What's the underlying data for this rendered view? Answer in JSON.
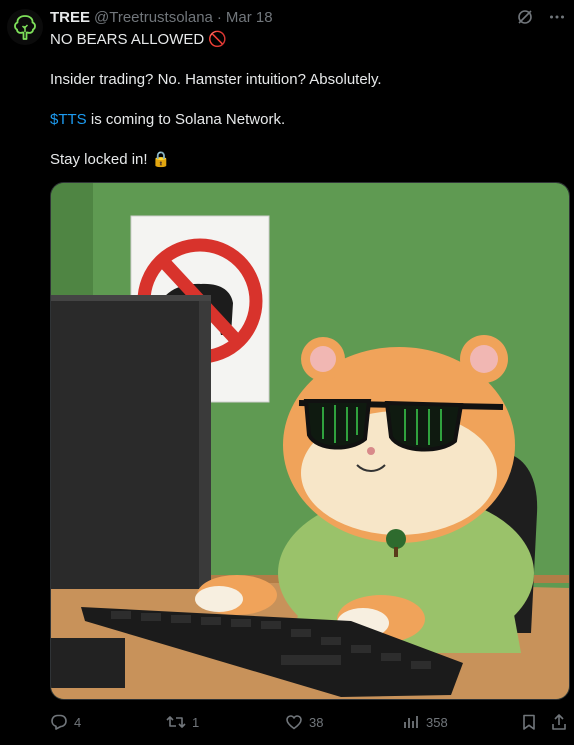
{
  "post": {
    "author_name": "TREE",
    "handle": "@Treetrustsolana",
    "separator": "·",
    "date": "Mar 18",
    "line1_text": "NO BEARS ALLOWED",
    "line1_emoji": "🚫",
    "line2": "Insider trading? No. Hamster intuition? Absolutely.",
    "line3_cashtag": "$TTS",
    "line3_rest": " is coming to Solana Network.",
    "line4_text": "Stay locked in!",
    "line4_emoji": "🔒"
  },
  "actions": {
    "replies": "4",
    "reposts": "1",
    "likes": "38",
    "views": "358"
  },
  "colors": {
    "background": "#000000",
    "text": "#e7e9ea",
    "muted": "#71767b",
    "link": "#1d9bf0",
    "avatar_tree": "#7ee05a"
  },
  "icons": [
    "tree-avatar-icon",
    "grok-icon",
    "more-icon",
    "reply-icon",
    "repost-icon",
    "like-icon",
    "views-icon",
    "bookmark-icon",
    "share-icon"
  ]
}
